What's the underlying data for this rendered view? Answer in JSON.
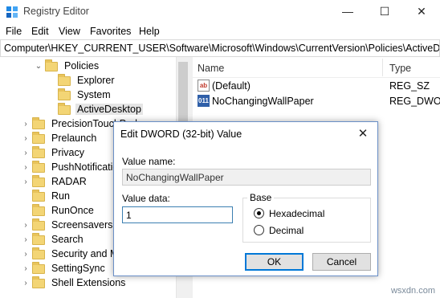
{
  "window": {
    "title": "Registry Editor",
    "icon": "registry-editor-icon",
    "controls": {
      "minimize": "—",
      "maximize": "☐",
      "close": "✕"
    }
  },
  "menu": [
    "File",
    "Edit",
    "View",
    "Favorites",
    "Help"
  ],
  "address": "Computer\\HKEY_CURRENT_USER\\Software\\Microsoft\\Windows\\CurrentVersion\\Policies\\ActiveDesktop",
  "tree": {
    "items": [
      {
        "label": "Policies",
        "chevron": "⌄"
      },
      {
        "label": "Explorer",
        "chevron": ""
      },
      {
        "label": "System",
        "chevron": ""
      },
      {
        "label": "ActiveDesktop",
        "chevron": ""
      },
      {
        "label": "PrecisionTouchPad",
        "chevron": "›"
      },
      {
        "label": "Prelaunch",
        "chevron": "›"
      },
      {
        "label": "Privacy",
        "chevron": "›"
      },
      {
        "label": "PushNotifications",
        "chevron": "›"
      },
      {
        "label": "RADAR",
        "chevron": "›"
      },
      {
        "label": "Run",
        "chevron": ""
      },
      {
        "label": "RunOnce",
        "chevron": ""
      },
      {
        "label": "Screensavers",
        "chevron": "›"
      },
      {
        "label": "Search",
        "chevron": "›"
      },
      {
        "label": "Security and Maintenance",
        "chevron": "›"
      },
      {
        "label": "SettingSync",
        "chevron": "›"
      },
      {
        "label": "Shell Extensions",
        "chevron": "›"
      }
    ],
    "selected": "ActiveDesktop"
  },
  "list": {
    "columns": {
      "name": "Name",
      "type": "Type"
    },
    "rows": [
      {
        "icon": "string-value-icon",
        "badge": "ab",
        "name": "(Default)",
        "type": "REG_SZ"
      },
      {
        "icon": "dword-value-icon",
        "badge": "011",
        "name": "NoChangingWallPaper",
        "type": "REG_DWORD"
      }
    ]
  },
  "dialog": {
    "title": "Edit DWORD (32-bit) Value",
    "close": "✕",
    "value_name_label": "Value name:",
    "value_name": "NoChangingWallPaper",
    "value_data_label": "Value data:",
    "value_data": "1",
    "base_label": "Base",
    "base_options": [
      "Hexadecimal",
      "Decimal"
    ],
    "base_selected": "Hexadecimal",
    "ok_label": "OK",
    "cancel_label": "Cancel"
  },
  "watermark": "wsxdn.com",
  "colors": {
    "accent": "#0078d7",
    "folder": "#f3d575",
    "selected_row": "#e5e5e5"
  }
}
